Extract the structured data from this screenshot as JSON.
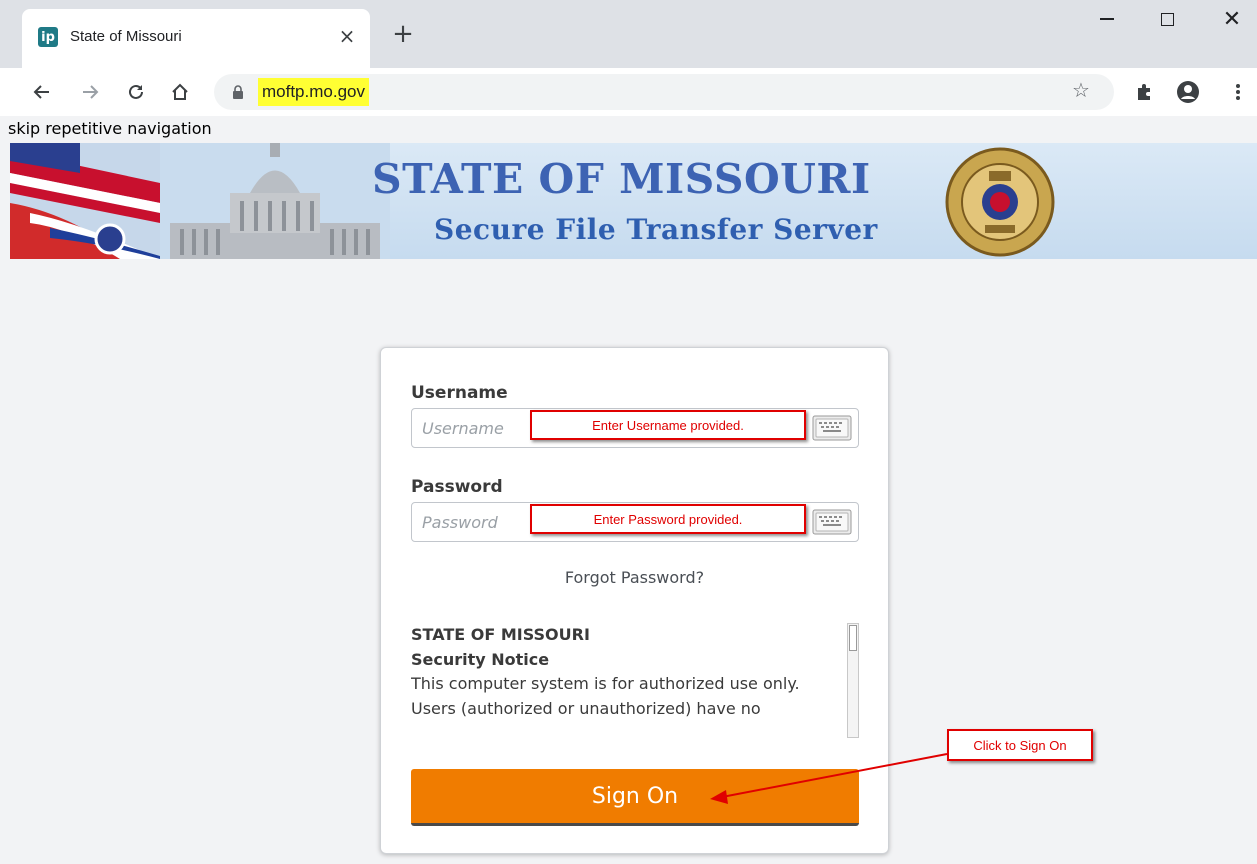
{
  "browser": {
    "tab_title": "State of Missouri",
    "tab_favicon": "ip",
    "tab_close": "×",
    "new_tab": "+",
    "url": "moftp.mo.gov",
    "icons": [
      "back-arrow-icon",
      "forward-arrow-icon",
      "reload-icon",
      "home-icon",
      "lock-icon",
      "star-icon",
      "extensions-icon",
      "profile-icon",
      "menu-icon"
    ]
  },
  "page": {
    "skip_link": "skip repetitive navigation",
    "banner": {
      "title": "STATE OF MISSOURI",
      "subtitle": "Secure File Transfer Server"
    },
    "login": {
      "username_label": "Username",
      "username_placeholder": "Username",
      "password_label": "Password",
      "password_placeholder": "Password",
      "forgot_password": "Forgot Password?",
      "notice": {
        "heading": "STATE OF MISSOURI",
        "subheading": "Security Notice",
        "line1": "This computer system is for authorized use only.",
        "line2": "Users (authorized or unauthorized) have no"
      },
      "sign_on": "Sign On"
    }
  },
  "annotations": {
    "username_hint": "Enter Username provided.",
    "password_hint": "Enter Password provided.",
    "sign_on_hint": "Click to Sign On",
    "color": "#e00000"
  },
  "colors": {
    "sign_on_button": "#f07c00",
    "banner_title": "#3d63b3",
    "url_highlight": "#ffff33"
  }
}
